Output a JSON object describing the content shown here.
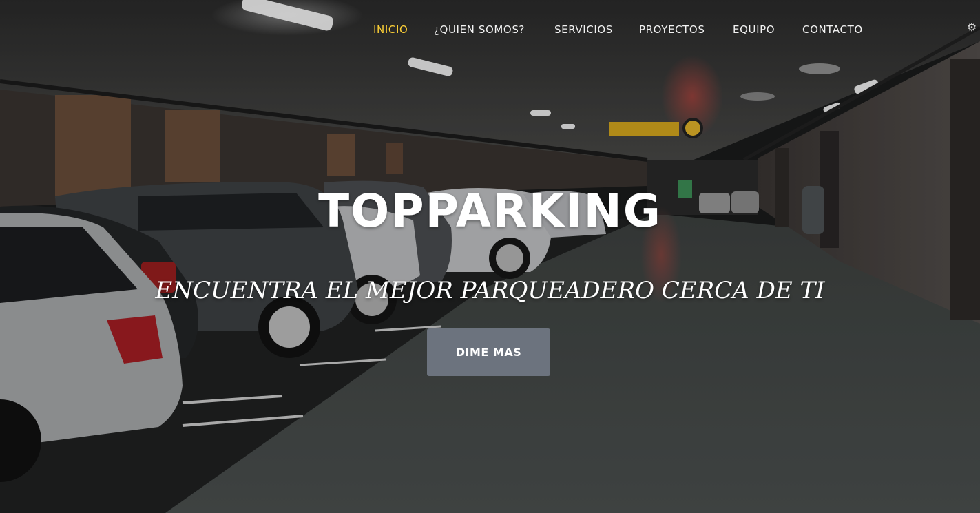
{
  "nav": {
    "items": [
      {
        "label": "INICIO",
        "active": true
      },
      {
        "label": "¿QUIEN SOMOS?",
        "active": false
      },
      {
        "label": "SERVICIOS",
        "active": false
      },
      {
        "label": "PROYECTOS",
        "active": false
      },
      {
        "label": "EQUIPO",
        "active": false
      },
      {
        "label": "CONTACTO",
        "active": false
      }
    ],
    "active_color": "#fed136",
    "corner_icon": "settings-icon"
  },
  "hero": {
    "title": "TOPPARKING",
    "subtitle": "ENCUENTRA EL MEJOR PARQUEADERO CERCA DE TI",
    "cta_label": "DIME MAS",
    "cta_color": "#6c737e",
    "background": "parking-garage-photo"
  }
}
